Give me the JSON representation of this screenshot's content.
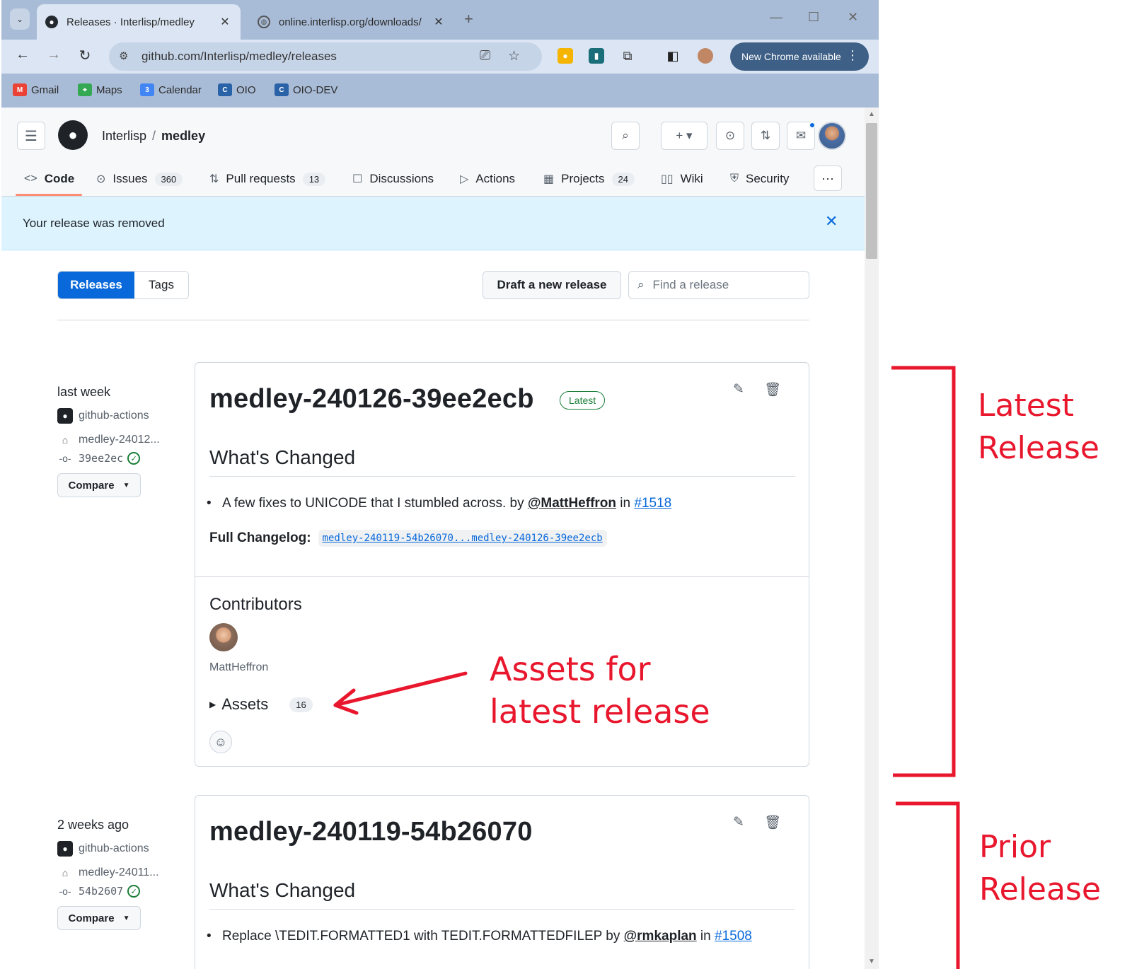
{
  "browser": {
    "tabs": [
      {
        "title": "Releases · Interlisp/medley",
        "active": true
      },
      {
        "title": "online.interlisp.org/downloads/",
        "active": false
      }
    ],
    "url": "github.com/Interlisp/medley/releases",
    "new_chrome_label": "New Chrome available",
    "bookmarks": [
      "Gmail",
      "Maps",
      "Calendar",
      "OIO",
      "OIO-DEV"
    ]
  },
  "repo": {
    "owner": "Interlisp",
    "separator": "/",
    "name": "medley"
  },
  "repo_nav": [
    {
      "label": "Code",
      "icon": "code-icon"
    },
    {
      "label": "Issues",
      "count": "360",
      "icon": "issue-icon"
    },
    {
      "label": "Pull requests",
      "count": "13",
      "icon": "pull-request-icon"
    },
    {
      "label": "Discussions",
      "icon": "discussion-icon"
    },
    {
      "label": "Actions",
      "icon": "play-icon"
    },
    {
      "label": "Projects",
      "count": "24",
      "icon": "table-icon"
    },
    {
      "label": "Wiki",
      "icon": "book-icon"
    },
    {
      "label": "Security",
      "icon": "shield-icon"
    }
  ],
  "flash": {
    "message": "Your release was removed"
  },
  "subnav": {
    "releases": "Releases",
    "tags": "Tags"
  },
  "draft_button": "Draft a new release",
  "find_placeholder": "Find a release",
  "releases": [
    {
      "when": "last week",
      "author": "github-actions",
      "tag": "medley-24012...",
      "commit": "39ee2ec",
      "compare": "Compare",
      "title": "medley-240126-39ee2ecb",
      "badge": "Latest",
      "whats_changed": "What's Changed",
      "change_text": "A few fixes to UNICODE that I stumbled across. by ",
      "change_user": "@MattHeffron",
      "change_in": " in ",
      "change_pr": "#1518",
      "full_changelog_label": "Full Changelog:",
      "full_changelog_link": "medley-240119-54b26070...medley-240126-39ee2ecb",
      "contributors_heading": "Contributors",
      "contributor": "MattHeffron",
      "assets_label": "Assets",
      "assets_count": "16"
    },
    {
      "when": "2 weeks ago",
      "author": "github-actions",
      "tag": "medley-24011...",
      "commit": "54b2607",
      "compare": "Compare",
      "title": "medley-240119-54b26070",
      "whats_changed": "What's Changed",
      "change_text": "Replace \\TEDIT.FORMATTED1 with TEDIT.FORMATTEDFILEP by ",
      "change_user": "@rmkaplan",
      "change_in": " in ",
      "change_pr": "#1508"
    }
  ],
  "annotations": {
    "latest_line1": "Latest",
    "latest_line2": "Release",
    "assets_line1": "Assets for",
    "assets_line2": "latest release",
    "prior_line1": "Prior",
    "prior_line2": "Release",
    "color": "#e8172d"
  },
  "colors": {
    "accent": "#0969da",
    "flash_bg": "#ddf4ff",
    "latest_green": "#1a7f37",
    "chrome_frame": "#a9bcd7"
  }
}
